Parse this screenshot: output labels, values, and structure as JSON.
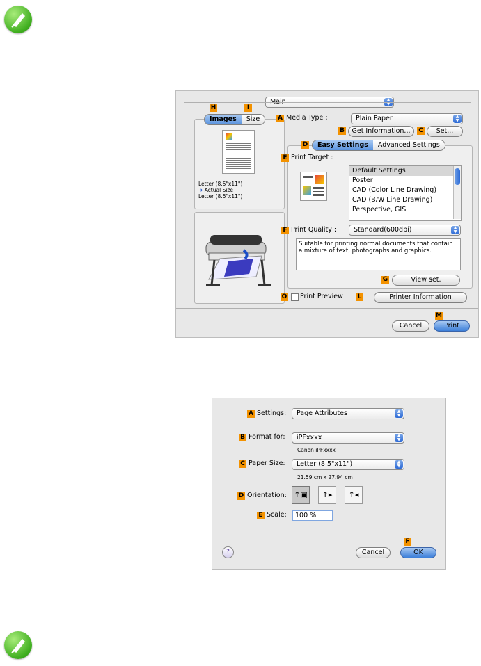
{
  "dialog1": {
    "main_popup": "Main",
    "tabs": {
      "images": "Images",
      "size": "Size"
    },
    "preview_text": {
      "line1": "Letter (8.5\"x11\")",
      "line2": "Actual Size",
      "line3": "Letter (8.5\"x11\")"
    },
    "media_type": {
      "label": "Media Type :",
      "value": "Plain Paper"
    },
    "get_info_button": "Get Information...",
    "set_button": "Set...",
    "settings_tabs": {
      "easy": "Easy Settings",
      "advanced": "Advanced Settings"
    },
    "print_target": {
      "label": "Print Target :",
      "items": [
        "Default Settings",
        "Poster",
        "CAD (Color Line Drawing)",
        "CAD (B/W Line Drawing)",
        "Perspective, GIS"
      ]
    },
    "print_quality": {
      "label": "Print Quality :",
      "value": "Standard(600dpi)"
    },
    "description": "Suitable for printing normal documents that contain a mixture of text, photographs and graphics.",
    "view_set_button": "View set.",
    "print_preview_label": "Print Preview",
    "printer_info_button": "Printer Information",
    "cancel_button": "Cancel",
    "print_button": "Print",
    "markers": {
      "a": "A",
      "b": "B",
      "c": "C",
      "d": "D",
      "e": "E",
      "f": "F",
      "g": "G",
      "h": "H",
      "i": "I",
      "l": "L",
      "m": "M",
      "o": "O"
    }
  },
  "dialog2": {
    "settings": {
      "label": "Settings:",
      "value": "Page Attributes"
    },
    "format_for": {
      "label": "Format for:",
      "value": "iPFxxxx",
      "sub": "Canon iPFxxxx"
    },
    "paper_size": {
      "label": "Paper Size:",
      "value": "Letter (8.5\"x11\")",
      "sub": "21.59 cm x 27.94 cm"
    },
    "orientation_label": "Orientation:",
    "scale": {
      "label": "Scale:",
      "value": "100 %"
    },
    "help_button": "?",
    "cancel_button": "Cancel",
    "ok_button": "OK",
    "markers": {
      "a": "A",
      "b": "B",
      "c": "C",
      "d": "D",
      "e": "E",
      "f": "F"
    }
  },
  "colors": {
    "marker": "#f39200",
    "note_icon": "#3fae1f",
    "accent": "#3c7fd9"
  }
}
